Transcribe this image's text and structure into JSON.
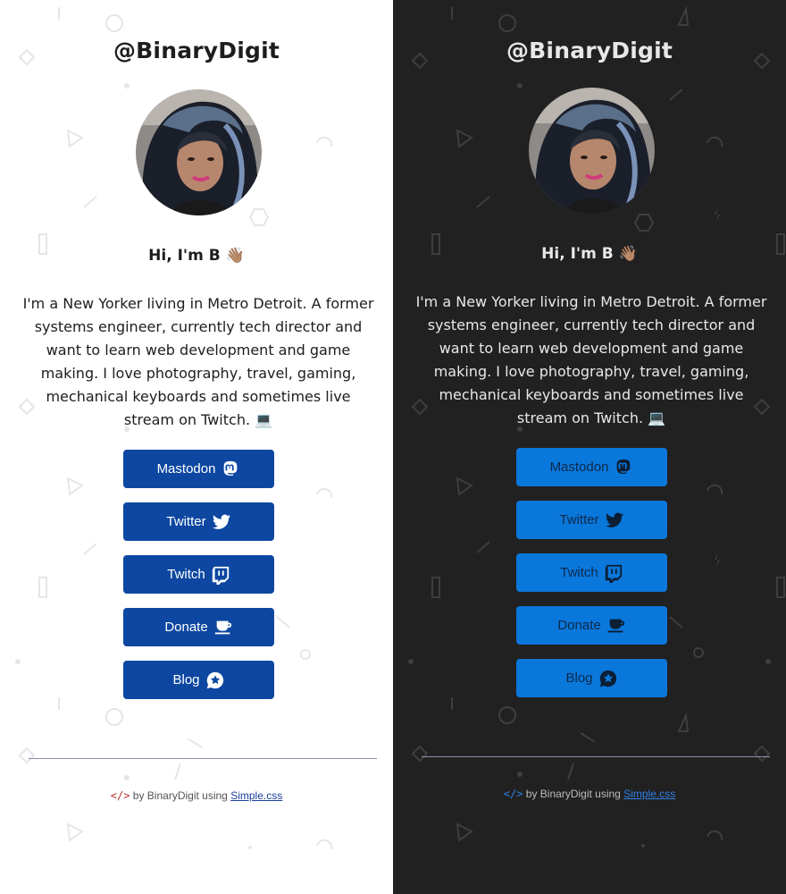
{
  "profile": {
    "handle": "@BinaryDigit",
    "greeting": "Hi, I'm B",
    "greeting_emoji": "👋🏽",
    "bio": "I'm a New Yorker living in Metro Detroit. A former systems engineer, currently tech director and want to learn web development and game making. I love photography, travel, gaming, mechanical keyboards and sometimes live stream on Twitch.",
    "bio_emoji": "💻"
  },
  "links": [
    {
      "label": "Mastodon",
      "icon": "mastodon-icon"
    },
    {
      "label": "Twitter",
      "icon": "twitter-icon"
    },
    {
      "label": "Twitch",
      "icon": "twitch-icon"
    },
    {
      "label": "Donate",
      "icon": "coffee-icon"
    },
    {
      "label": "Blog",
      "icon": "blog-star-icon"
    }
  ],
  "footer": {
    "code_icon": "</>",
    "text": "by BinaryDigit using",
    "link_label": "Simple.css"
  },
  "theme": {
    "light_bg": "#ffffff",
    "dark_bg": "#212121",
    "light_button": "#0d47a1",
    "dark_button": "#0a77db"
  }
}
